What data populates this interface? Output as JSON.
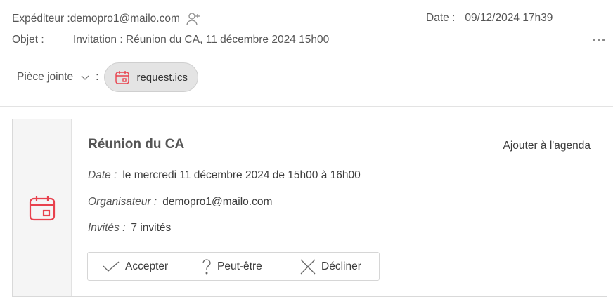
{
  "header": {
    "sender_label": "Expéditeur :",
    "sender_value": "demopro1@mailo.com",
    "date_label": "Date :",
    "date_value": "09/12/2024 17h39",
    "subject_label": "Objet :",
    "subject_value": "Invitation : Réunion du CA, 11 décembre 2024 15h00",
    "icons": {
      "add_contact": "person-plus-icon",
      "more": "more-horizontal-icon"
    }
  },
  "attachments": {
    "label": "Pièce jointe",
    "colon": ":",
    "items": [
      {
        "name": "request.ics",
        "icon": "calendar-icon"
      }
    ]
  },
  "invitation": {
    "title": "Réunion du CA",
    "add_to_agenda": "Ajouter à l'agenda",
    "date_label": "Date :",
    "date_value": "le mercredi 11 décembre 2024 de 15h00 à 16h00",
    "organizer_label": "Organisateur :",
    "organizer_value": "demopro1@mailo.com",
    "guests_label": "Invités :",
    "guests_value": "7 invités",
    "buttons": {
      "accept": "Accepter",
      "maybe": "Peut-être",
      "decline": "Décliner"
    }
  },
  "colors": {
    "accent_red": "#e8414d",
    "text": "#3c3c3c",
    "muted": "#555555"
  }
}
